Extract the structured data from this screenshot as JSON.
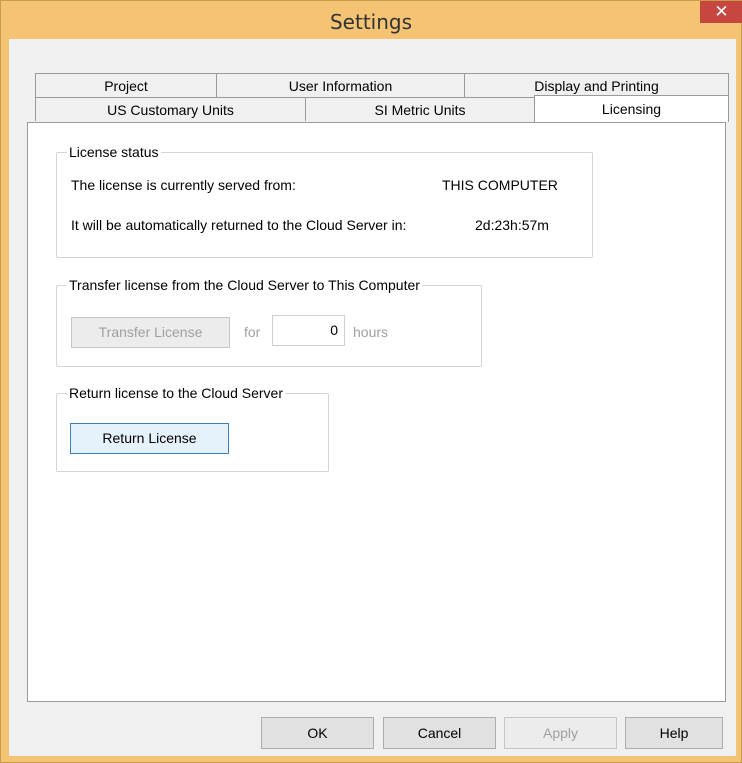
{
  "window": {
    "title": "Settings",
    "close_glyph": "✕"
  },
  "tabs": {
    "row1": [
      "Project",
      "User Information",
      "Display and Printing"
    ],
    "row2": [
      "US Customary Units",
      "SI Metric Units",
      "Licensing"
    ],
    "active": "Licensing"
  },
  "license_status": {
    "legend": "License status",
    "served_label": "The license is currently served from:",
    "served_value": "THIS COMPUTER",
    "return_label": "It will be automatically returned to the Cloud Server in:",
    "return_value": "2d:23h:57m"
  },
  "transfer": {
    "legend": "Transfer license from the Cloud Server to This Computer",
    "button": "Transfer License",
    "for_label": "for",
    "hours_value": "0",
    "hours_label": "hours"
  },
  "return_section": {
    "legend": "Return license to the Cloud Server",
    "button": "Return License"
  },
  "footer": {
    "ok": "OK",
    "cancel": "Cancel",
    "apply": "Apply",
    "help": "Help"
  },
  "colors": {
    "frame": "#f4c374",
    "close": "#c7463f",
    "primary_border": "#3c7fb1"
  }
}
